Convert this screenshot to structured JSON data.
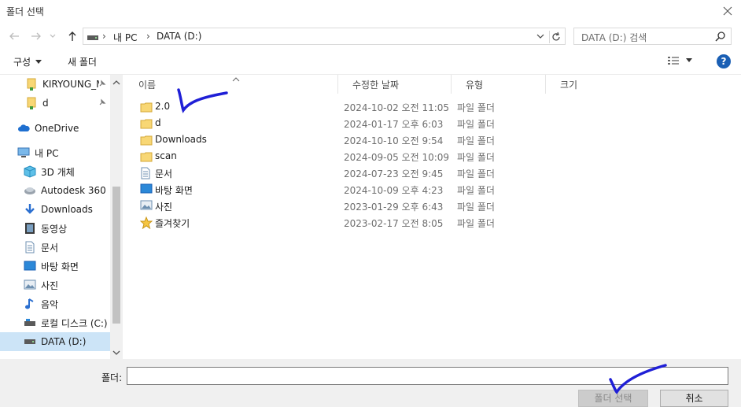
{
  "window": {
    "title": "폴더 선택"
  },
  "nav": {
    "path": [
      "내 PC",
      "DATA (D:)"
    ],
    "search_placeholder": "DATA (D:) 검색"
  },
  "toolbar": {
    "organize_label": "구성",
    "new_folder_label": "새 폴더"
  },
  "sidebar": {
    "items": [
      {
        "label": "KIRYOUNG_M",
        "icon": "folder-yellow-icon",
        "pinned": true
      },
      {
        "label": "d",
        "icon": "folder-yellow-icon",
        "pinned": true
      },
      {
        "label": "OneDrive",
        "icon": "cloud-icon"
      },
      {
        "label": "내 PC",
        "icon": "pc-icon"
      },
      {
        "label": "3D 개체",
        "icon": "cube-icon"
      },
      {
        "label": "Autodesk 360",
        "icon": "autodesk-icon"
      },
      {
        "label": "Downloads",
        "icon": "download-icon"
      },
      {
        "label": "동영상",
        "icon": "video-icon"
      },
      {
        "label": "문서",
        "icon": "document-icon"
      },
      {
        "label": "바탕 화면",
        "icon": "desktop-icon"
      },
      {
        "label": "사진",
        "icon": "picture-icon"
      },
      {
        "label": "음악",
        "icon": "music-icon"
      },
      {
        "label": "로컬 디스크 (C:)",
        "icon": "drive-icon"
      },
      {
        "label": "DATA (D:)",
        "icon": "drive-icon",
        "selected": true
      }
    ]
  },
  "columns": {
    "name": "이름",
    "modified": "수정한 날짜",
    "type": "유형",
    "size": "크기"
  },
  "files": [
    {
      "name": "2.0",
      "date": "2024-10-02 오전 11:05",
      "type": "파일 폴더",
      "icon": "folder-icon"
    },
    {
      "name": "d",
      "date": "2024-01-17 오후 6:03",
      "type": "파일 폴더",
      "icon": "folder-icon"
    },
    {
      "name": "Downloads",
      "date": "2024-10-10 오전 9:54",
      "type": "파일 폴더",
      "icon": "folder-icon"
    },
    {
      "name": "scan",
      "date": "2024-09-05 오전 10:09",
      "type": "파일 폴더",
      "icon": "folder-icon"
    },
    {
      "name": "문서",
      "date": "2024-07-23 오전 9:45",
      "type": "파일 폴더",
      "icon": "document-icon"
    },
    {
      "name": "바탕 화면",
      "date": "2024-10-09 오후 4:23",
      "type": "파일 폴더",
      "icon": "desktop-icon"
    },
    {
      "name": "사진",
      "date": "2023-01-29 오후 6:43",
      "type": "파일 폴더",
      "icon": "picture-icon"
    },
    {
      "name": "즐겨찾기",
      "date": "2023-02-17 오전 8:05",
      "type": "파일 폴더",
      "icon": "star-icon"
    }
  ],
  "footer": {
    "folder_label": "폴더:",
    "folder_value": "",
    "select_button": "폴더 선택",
    "cancel_button": "취소"
  },
  "colors": {
    "folder": "#f8d775",
    "accent": "#1a5fb4",
    "selection": "#cce4f7",
    "annotation": "#1f1fd6"
  }
}
